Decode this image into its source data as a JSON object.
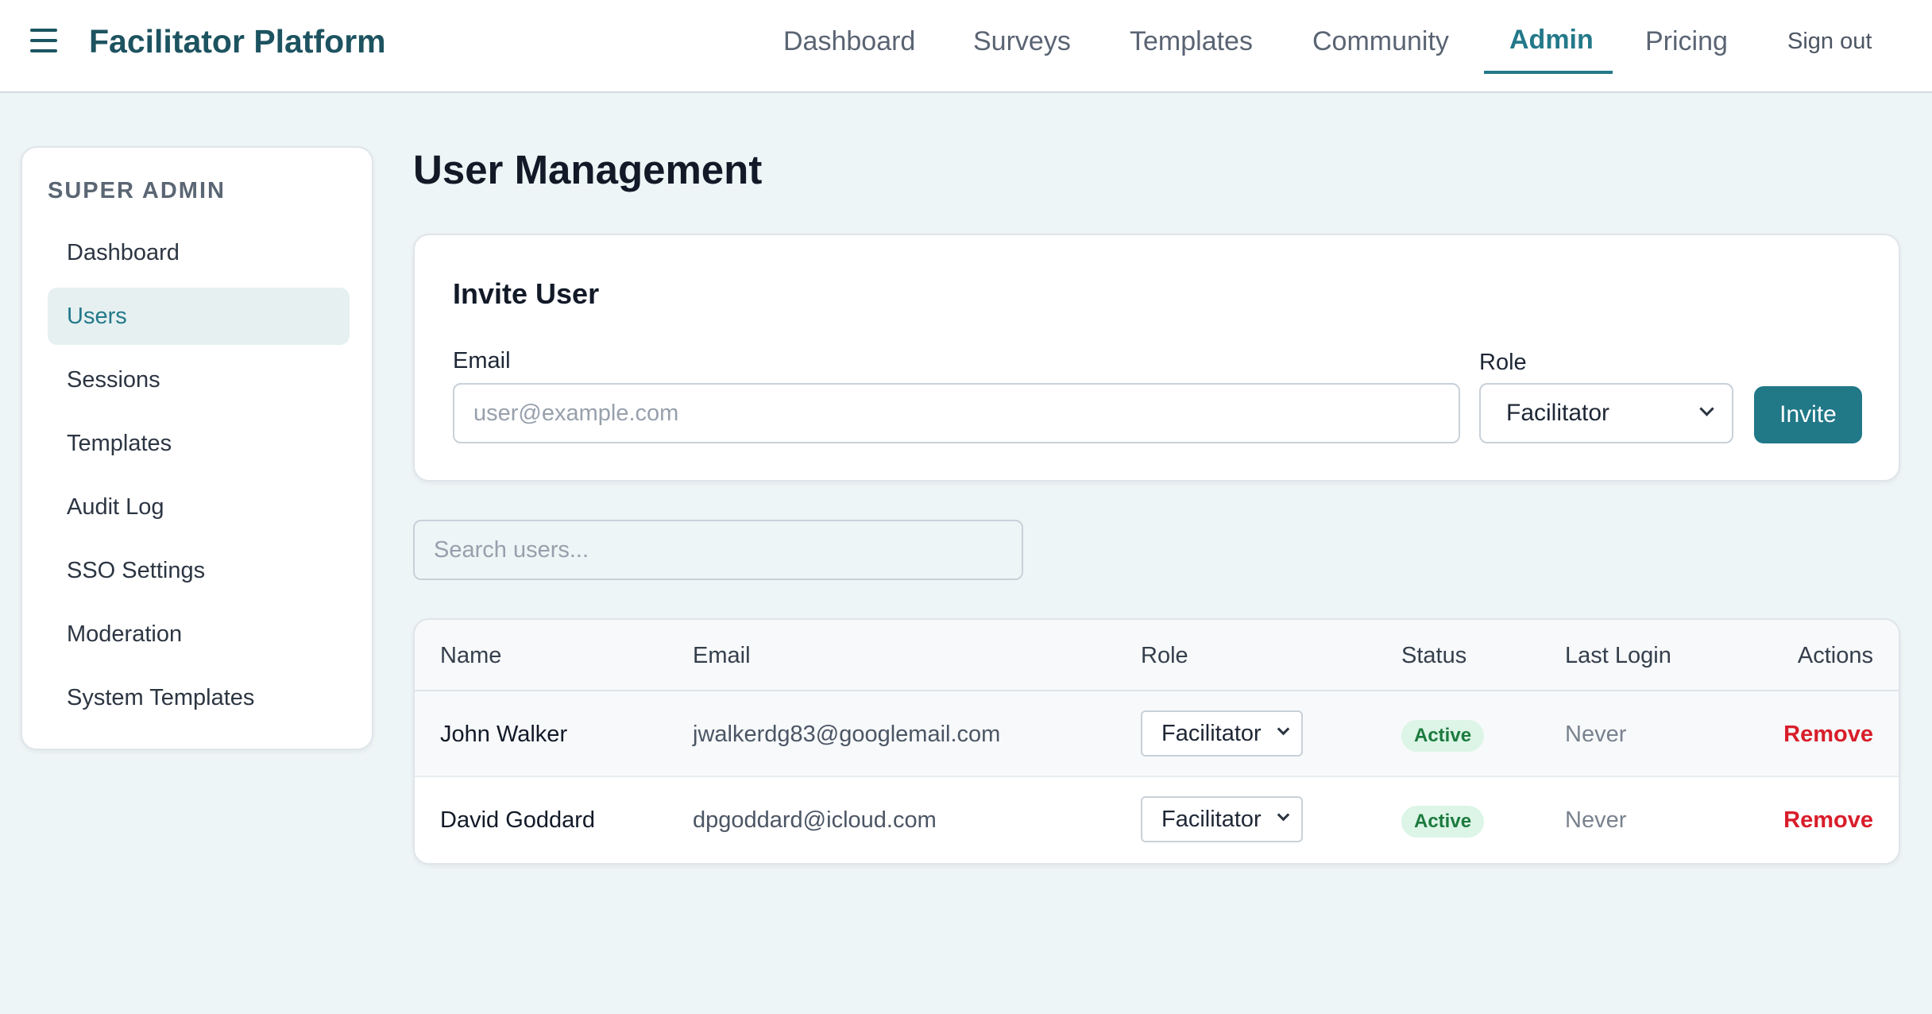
{
  "app": {
    "title": "Facilitator Platform",
    "menu_icon": "hamburger-menu-icon"
  },
  "nav": {
    "items": [
      {
        "label": "Dashboard"
      },
      {
        "label": "Surveys"
      },
      {
        "label": "Templates"
      },
      {
        "label": "Community"
      },
      {
        "label": "Admin",
        "active": true
      },
      {
        "label": "Pricing"
      }
    ],
    "sign_out": "Sign out"
  },
  "sidebar": {
    "title": "SUPER ADMIN",
    "items": [
      {
        "label": "Dashboard"
      },
      {
        "label": "Users",
        "active": true
      },
      {
        "label": "Sessions"
      },
      {
        "label": "Templates"
      },
      {
        "label": "Audit Log"
      },
      {
        "label": "SSO Settings"
      },
      {
        "label": "Moderation"
      },
      {
        "label": "System Templates"
      }
    ]
  },
  "main": {
    "title": "User Management",
    "invite": {
      "title": "Invite User",
      "email_label": "Email",
      "email_placeholder": "user@example.com",
      "email_value": "",
      "role_label": "Role",
      "role_value": "Facilitator",
      "button_label": "Invite"
    },
    "search": {
      "placeholder": "Search users...",
      "value": ""
    },
    "table": {
      "columns": [
        "Name",
        "Email",
        "Role",
        "Status",
        "Last Login",
        "Actions"
      ],
      "rows": [
        {
          "name": "John Walker",
          "email": "jwalkerdg83@googlemail.com",
          "role": "Facilitator",
          "status": "Active",
          "last_login": "Never",
          "action": "Remove"
        },
        {
          "name": "David Goddard",
          "email": "dpgoddard@icloud.com",
          "role": "Facilitator",
          "status": "Active",
          "last_login": "Never",
          "action": "Remove"
        }
      ]
    }
  },
  "colors": {
    "brand": "#1d5360",
    "accent": "#23798a",
    "page_background": "#eef5f6",
    "danger": "#d81d2a",
    "status_active_bg": "#dcf5e6",
    "status_active_text": "#1c7a3f"
  }
}
